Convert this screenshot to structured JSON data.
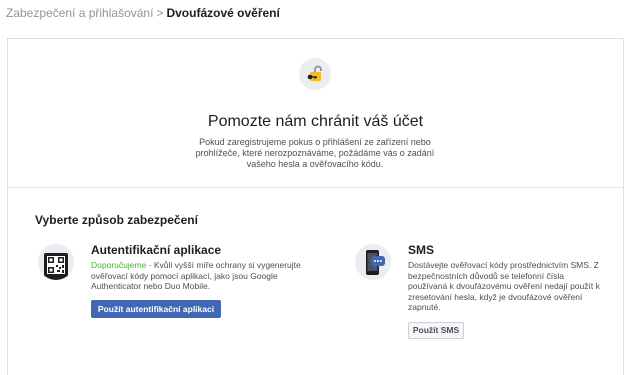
{
  "breadcrumb": {
    "parent": "Zabezpečení a přihlašování",
    "separator": ">",
    "current": "Dvoufázové ověření"
  },
  "hero": {
    "icon": "padlock-key-icon",
    "title": "Pomozte nám chránit váš účet",
    "description": "Pokud zaregistrujeme pokus o přihlášení ze zařízení nebo prohlížeče, které nerozpoznáváme, požádáme vás o zadání vašeho hesla a ověřovacího kódu."
  },
  "methods": {
    "heading": "Vyberte způsob zabezpečení",
    "auth_app": {
      "icon": "qr-phone-icon",
      "title": "Autentifikační aplikace",
      "recommended": "Doporučujeme",
      "separator": " · ",
      "description": "Kvůli vyšší míře ochrany si vygenerujte ověřovací kódy pomocí aplikací, jako jsou Google Authenticator nebo Duo Mobile.",
      "button": "Použít autentifikační aplikaci"
    },
    "sms": {
      "icon": "sms-phone-icon",
      "title": "SMS",
      "description": "Dostávejte ověřovací kódy prostřednictvím SMS. Z bezpečnostních důvodů se telefonní čísla používaná k dvoufázovému ověření nedají použít k zresetování hesla, když je dvoufázové ověření zapnuté.",
      "button": "Použít SMS"
    }
  },
  "colors": {
    "accent_blue": "#4267b2",
    "recommended_green": "#42b72a",
    "lock_yellow": "#f7b928"
  }
}
